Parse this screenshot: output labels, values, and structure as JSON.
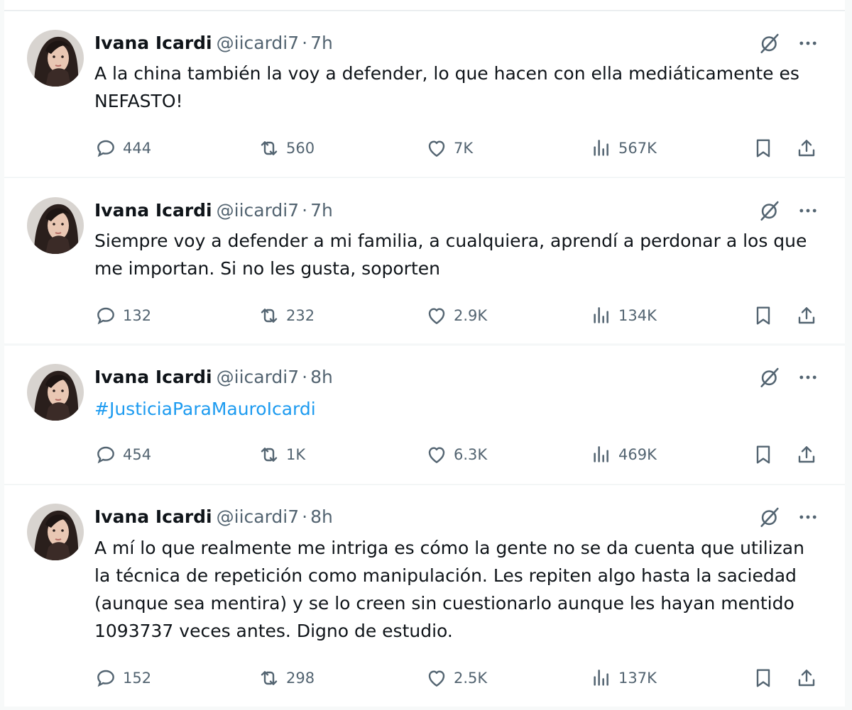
{
  "tweets": [
    {
      "name": "Ivana Icardi",
      "handle": "@iicardi7",
      "separator": "·",
      "time": "7h",
      "text": "A la china también la voy a defender, lo que hacen con ella mediáticamente es NEFASTO!",
      "is_hashtag": false,
      "replies": "444",
      "reposts": "560",
      "likes": "7K",
      "views": "567K"
    },
    {
      "name": "Ivana Icardi",
      "handle": "@iicardi7",
      "separator": "·",
      "time": "7h",
      "text": "Siempre voy a defender a mi familia, a cualquiera, aprendí a perdonar a los que me importan. Si no les gusta, soporten",
      "is_hashtag": false,
      "replies": "132",
      "reposts": "232",
      "likes": "2.9K",
      "views": "134K"
    },
    {
      "name": "Ivana Icardi",
      "handle": "@iicardi7",
      "separator": "·",
      "time": "8h",
      "text": "#JusticiaParaMauroIcardi",
      "is_hashtag": true,
      "replies": "454",
      "reposts": "1K",
      "likes": "6.3K",
      "views": "469K"
    },
    {
      "name": "Ivana Icardi",
      "handle": "@iicardi7",
      "separator": "·",
      "time": "8h",
      "text": "A mí lo que realmente me intriga es cómo la gente no se da cuenta que utilizan la técnica de repetición como manipulación. Les repiten algo hasta la saciedad (aunque sea mentira) y se lo creen sin cuestionarlo aunque les hayan mentido 1093737 veces antes. Digno de estudio.",
      "is_hashtag": false,
      "replies": "152",
      "reposts": "298",
      "likes": "2.5K",
      "views": "137K"
    }
  ],
  "icons": {
    "grok": "grok-icon",
    "more": "more-icon",
    "reply": "reply-icon",
    "repost": "repost-icon",
    "like": "heart-icon",
    "views": "views-icon",
    "bookmark": "bookmark-icon",
    "share": "share-icon"
  },
  "colors": {
    "text": "#0f1419",
    "secondary": "#536471",
    "hashtag": "#1d9bf0",
    "background": "#ffffff",
    "divider": "#eff3f4"
  }
}
